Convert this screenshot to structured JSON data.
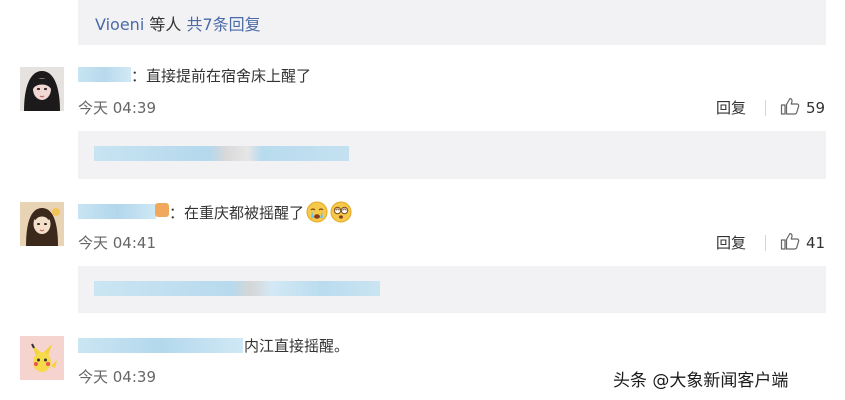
{
  "top_reply": {
    "user": "Vioeni",
    "suffix": " 等人 ",
    "count_label": "共7条回复"
  },
  "comments": [
    {
      "text": "：直接提前在宿舍床上醒了",
      "time": "今天 04:39",
      "reply_label": "回复",
      "likes": "59"
    },
    {
      "text": "：在重庆都被摇醒了",
      "time": "今天 04:41",
      "reply_label": "回复",
      "likes": "41",
      "emojis": [
        "crying-face",
        "dizzy-face"
      ]
    },
    {
      "text": "内江直接摇醒。",
      "time": "今天 04:39"
    }
  ],
  "watermark": "头条 @大象新闻客户端",
  "colors": {
    "link": "#4a6ba6",
    "reply_bg": "#f2f2f5",
    "blur": "#b9dced"
  }
}
